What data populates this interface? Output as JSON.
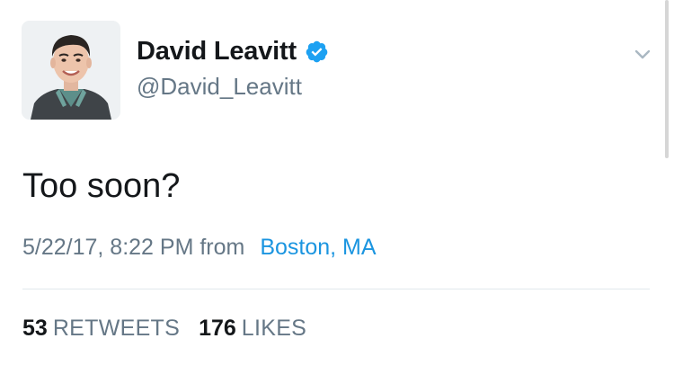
{
  "tweet": {
    "author": {
      "display_name": "David Leavitt",
      "handle": "@David_Leavitt",
      "verified": true,
      "avatar_icon": "profile-photo"
    },
    "text": "Too soon?",
    "timestamp": "5/22/17, 8:22 PM",
    "from_label": "from",
    "location": "Boston, MA",
    "stats": {
      "retweets_count": "53",
      "retweets_label": "RETWEETS",
      "likes_count": "176",
      "likes_label": "LIKES"
    },
    "menu_icon": "chevron-down-icon"
  },
  "colors": {
    "link_blue": "#1b95e0",
    "secondary_text": "#657786",
    "primary_text": "#14171a",
    "divider": "#e1e8ed"
  }
}
